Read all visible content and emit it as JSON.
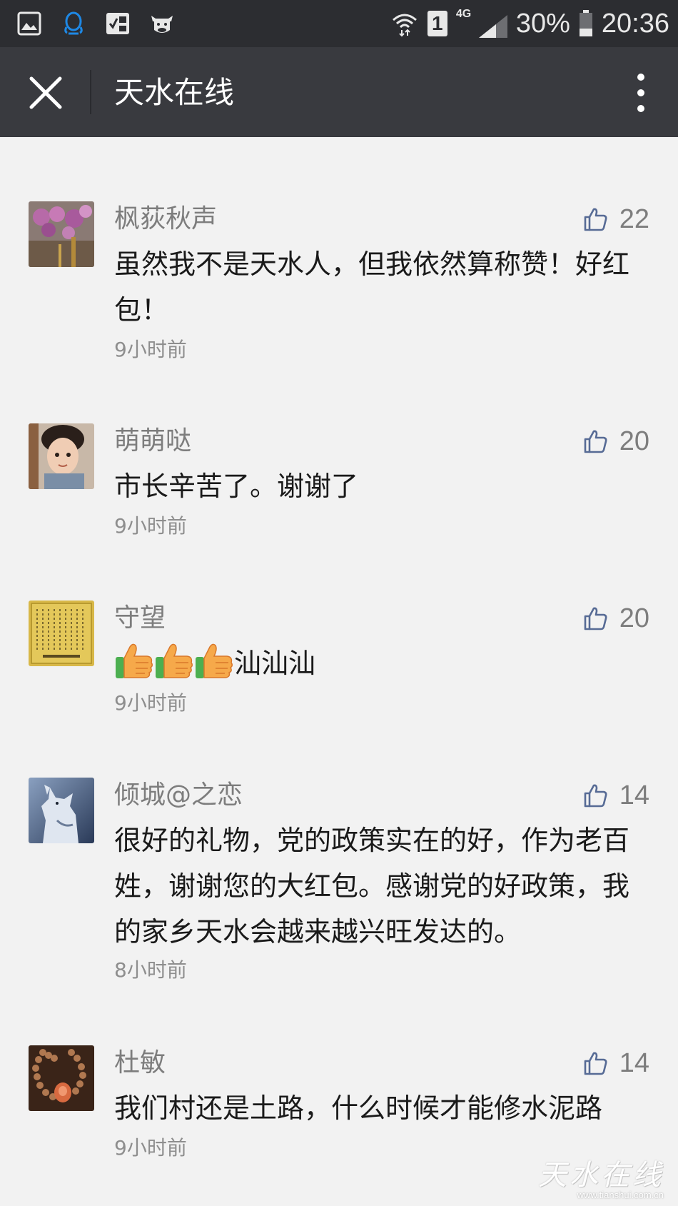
{
  "status_bar": {
    "icons_left": [
      "gallery-icon",
      "qq-icon",
      "calculator-icon",
      "cow-icon"
    ],
    "icons_right": [
      "wifi-icon",
      "sim-1-icon",
      "4g-signal-icon",
      "battery-icon"
    ],
    "network": "4G",
    "sim": "1",
    "battery": "30%",
    "time": "20:36"
  },
  "header": {
    "title": "天水在线"
  },
  "comments": [
    {
      "name": "枫荻秋声",
      "likes": "22",
      "text": "虽然我不是天水人，但我依然算称赞！好红包！",
      "time": "9小时前",
      "avatar": "flowers-avatar"
    },
    {
      "name": "萌萌哒",
      "likes": "20",
      "text": "市长辛苦了。谢谢了",
      "time": "9小时前",
      "avatar": "child-avatar"
    },
    {
      "name": "守望",
      "likes": "20",
      "text": "汕汕汕",
      "emoji_count": 3,
      "time": "9小时前",
      "avatar": "calligraphy-avatar"
    },
    {
      "name": "倾城@之恋",
      "likes": "14",
      "text": "很好的礼物，党的政策实在的好，作为老百姓，谢谢您的大红包。感谢党的好政策，我的家乡天水会越来越兴旺发达的。",
      "time": "8小时前",
      "avatar": "wolf-avatar"
    },
    {
      "name": "杜敏",
      "likes": "14",
      "text": "我们村还是土路，什么时候才能修水泥路",
      "time": "9小时前",
      "avatar": "beads-avatar"
    }
  ],
  "watermark": {
    "text": "天水在线",
    "url": "www.tianshui.com.cn"
  },
  "colors": {
    "status_bar_bg": "#2c2d31",
    "header_bg": "#393a3f",
    "page_bg": "#f2f2f2",
    "like_icon": "#576b95",
    "meta_text": "#7d7d7d"
  }
}
